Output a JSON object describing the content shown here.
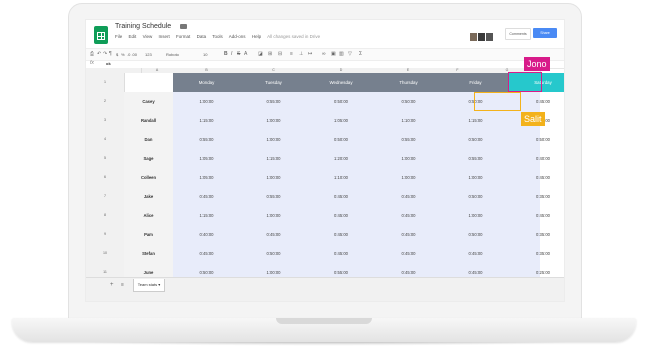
{
  "app": {
    "title": "Training Schedule",
    "menus": [
      "File",
      "Edit",
      "View",
      "Insert",
      "Format",
      "Data",
      "Tools",
      "Add-ons",
      "Help"
    ],
    "save_status": "All changes saved in Drive",
    "comments_label": "Comments",
    "share_label": "Share",
    "folder_icon": "folder-icon",
    "logo_icon": "sheets-logo-icon"
  },
  "toolbar": {
    "zoom": "100%",
    "font": "Roboto",
    "font_size": "10",
    "format_123": "123",
    "percent": "%",
    "decimals": ".0 .00"
  },
  "formula_bar": {
    "fx": "fx",
    "cell_ref": "ok"
  },
  "columns": [
    "A",
    "B",
    "C",
    "D",
    "E",
    "F",
    "G"
  ],
  "days": [
    "Monday",
    "Tuesday",
    "Wednesday",
    "Thursday",
    "Friday",
    "Saturday"
  ],
  "rows": [
    {
      "num": "1",
      "name": "",
      "times": [
        "",
        "",
        "",
        "",
        "",
        ""
      ]
    },
    {
      "num": "2",
      "name": "Casey",
      "times": [
        "1:00:00",
        "0:55:00",
        "0:50:00",
        "0:50:00",
        "0:50:00",
        "0:45:00"
      ]
    },
    {
      "num": "3",
      "name": "Randall",
      "times": [
        "1:15:00",
        "1:00:00",
        "1:05:00",
        "1:10:00",
        "1:15:00",
        "0:55:00"
      ]
    },
    {
      "num": "4",
      "name": "Dan",
      "times": [
        "0:55:00",
        "1:00:00",
        "0:50:00",
        "0:55:00",
        "0:50:00",
        "0:50:00"
      ]
    },
    {
      "num": "5",
      "name": "Sage",
      "times": [
        "1:05:00",
        "1:15:00",
        "1:20:00",
        "1:00:00",
        "0:55:00",
        "0:40:00"
      ]
    },
    {
      "num": "6",
      "name": "Colleen",
      "times": [
        "1:05:00",
        "1:00:00",
        "1:10:00",
        "1:00:00",
        "1:00:00",
        "0:45:00"
      ]
    },
    {
      "num": "7",
      "name": "Jake",
      "times": [
        "0:45:00",
        "0:55:00",
        "0:45:00",
        "0:45:00",
        "0:50:00",
        "0:35:00"
      ]
    },
    {
      "num": "8",
      "name": "Alice",
      "times": [
        "1:15:00",
        "1:00:00",
        "0:45:00",
        "0:45:00",
        "1:00:00",
        "0:45:00"
      ]
    },
    {
      "num": "9",
      "name": "Pam",
      "times": [
        "0:40:00",
        "0:45:00",
        "0:45:00",
        "0:45:00",
        "0:50:00",
        "0:35:00"
      ]
    },
    {
      "num": "10",
      "name": "Stefan",
      "times": [
        "0:45:00",
        "0:50:00",
        "0:45:00",
        "0:45:00",
        "0:45:00",
        "0:35:00"
      ]
    },
    {
      "num": "11",
      "name": "June",
      "times": [
        "0:50:00",
        "1:00:00",
        "0:55:00",
        "0:45:00",
        "0:45:00",
        "0:25:00"
      ]
    }
  ],
  "sheet_tab": "Team stats",
  "collaborators": [
    {
      "name": "Jono",
      "color": "#d81b8a"
    },
    {
      "name": "Salit",
      "color": "#f3b21b"
    }
  ],
  "selection_colors": {
    "header": "#26c8cc",
    "cursor_jono": "#d81b8a",
    "cursor_salit": "#f3b21b"
  }
}
